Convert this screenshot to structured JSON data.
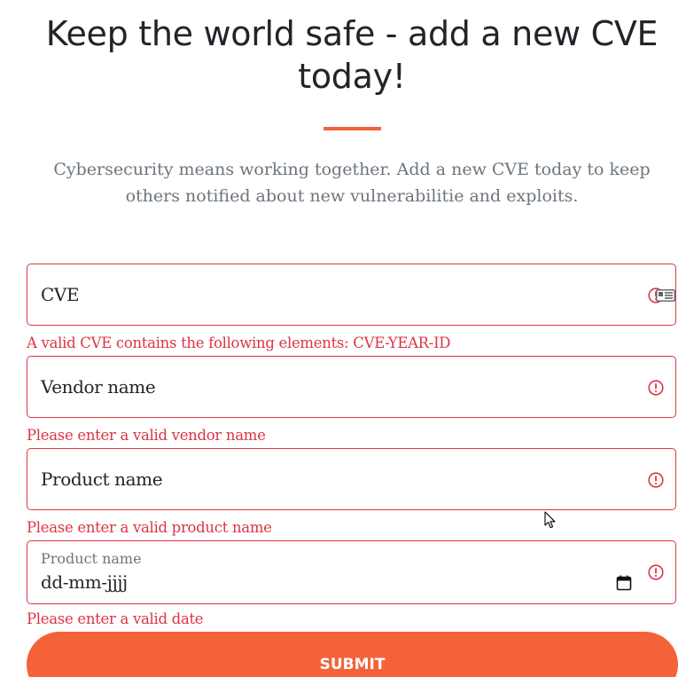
{
  "header": {
    "title": "Keep the world safe - add a new CVE today!",
    "lead": "Cybersecurity means working together. Add a new CVE today to keep others notified about new vulnerabilitie and exploits."
  },
  "form": {
    "cve": {
      "placeholder": "CVE",
      "feedback": "A valid CVE contains the following elements: CVE-YEAR-ID"
    },
    "vendor": {
      "placeholder": "Vendor name",
      "feedback": "Please enter a valid vendor name"
    },
    "product": {
      "placeholder": "Product name",
      "feedback": "Please enter a valid product name"
    },
    "date": {
      "label": "Product name",
      "value": "dd-mm-jjjj",
      "feedback": "Please enter a valid date"
    },
    "submit_label": "SUBMIT"
  },
  "colors": {
    "primary": "#f4623a",
    "invalid": "#dc3545",
    "heading": "#212529",
    "muted": "#6c757d"
  },
  "icons": {
    "invalid": "exclamation-circle-icon",
    "autofill": "contact-card-icon",
    "calendar": "calendar-icon",
    "cursor": "mouse-pointer-icon"
  }
}
